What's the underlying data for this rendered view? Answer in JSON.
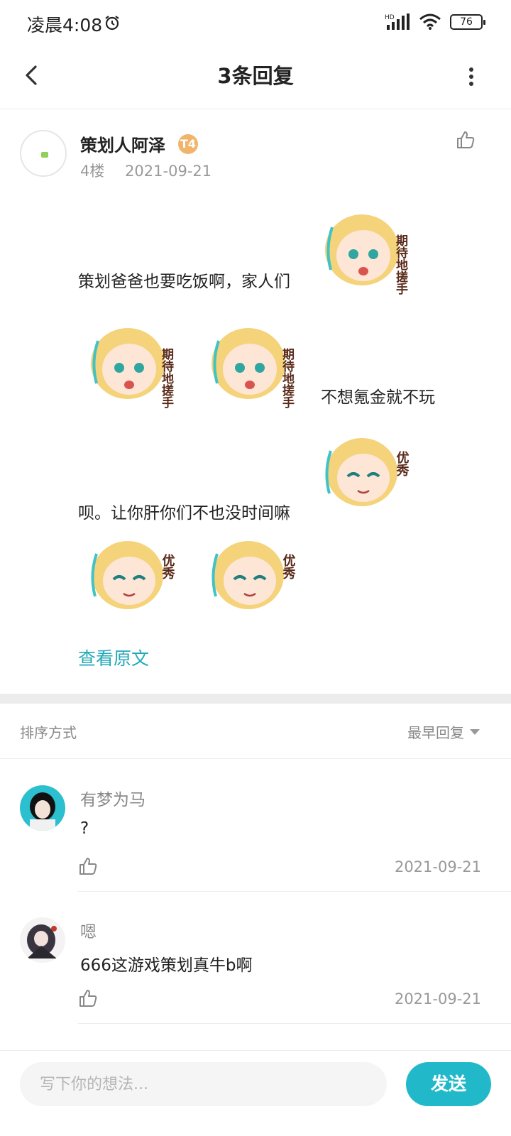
{
  "status_bar": {
    "time": "凌晨4:08",
    "network": "HD",
    "battery": "76"
  },
  "header": {
    "title": "3条回复"
  },
  "post": {
    "author": "策划人阿泽",
    "badge": "T4",
    "floor": "4楼",
    "date": "2021-09-21",
    "text_1": "策划爸爸也要吃饭啊，家人们",
    "text_2": "不想氪金就不玩",
    "text_3": "呗。让你肝你们不也没时间嘛",
    "stickers": {
      "expect_caption": "期待地搓手",
      "excellent_caption": "优秀"
    },
    "view_original": "查看原文"
  },
  "sort": {
    "label": "排序方式",
    "value": "最早回复"
  },
  "replies": [
    {
      "name": "有梦为马",
      "text": "?",
      "date": "2021-09-21"
    },
    {
      "name": "嗯",
      "text": "666这游戏策划真牛b啊",
      "date": "2021-09-21"
    }
  ],
  "composer": {
    "placeholder": "写下你的想法...",
    "send_label": "发送"
  },
  "colors": {
    "accent": "#21b9c9",
    "link": "#21a9b9",
    "muted": "#999999"
  }
}
